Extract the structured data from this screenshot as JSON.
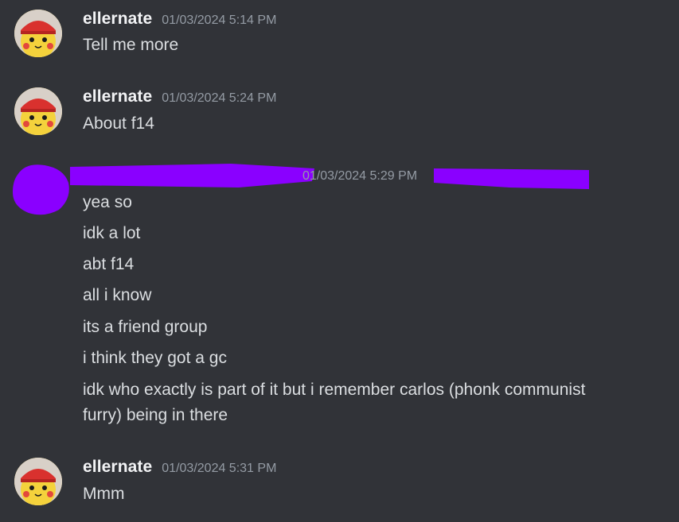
{
  "messages": [
    {
      "username": "ellernate",
      "timestamp": "01/03/2024 5:14 PM",
      "avatar_icon": "pikachu-avatar-icon",
      "lines": [
        "Tell me more"
      ]
    },
    {
      "username": "ellernate",
      "timestamp": "01/03/2024 5:24 PM",
      "avatar_icon": "pikachu-avatar-icon",
      "lines": [
        "About f14"
      ]
    },
    {
      "username": "",
      "username_redacted": true,
      "timestamp": "01/03/2024 5:29 PM",
      "avatar_icon": "redacted-avatar",
      "lines": [
        "yea so",
        "idk a lot",
        "abt f14",
        "all i know",
        "its a friend group",
        "i think they got a gc",
        "idk who exactly is part of it but i remember carlos (phonk communist",
        "furry) being in there"
      ]
    },
    {
      "username": "ellernate",
      "timestamp": "01/03/2024 5:31 PM",
      "avatar_icon": "pikachu-avatar-icon",
      "lines": [
        "Mmm"
      ]
    }
  ],
  "colors": {
    "background": "#313338",
    "username": "#f2f3f5",
    "timestamp": "#949ba4",
    "message_text": "#dbdee1",
    "redaction": "#8a00ff"
  }
}
